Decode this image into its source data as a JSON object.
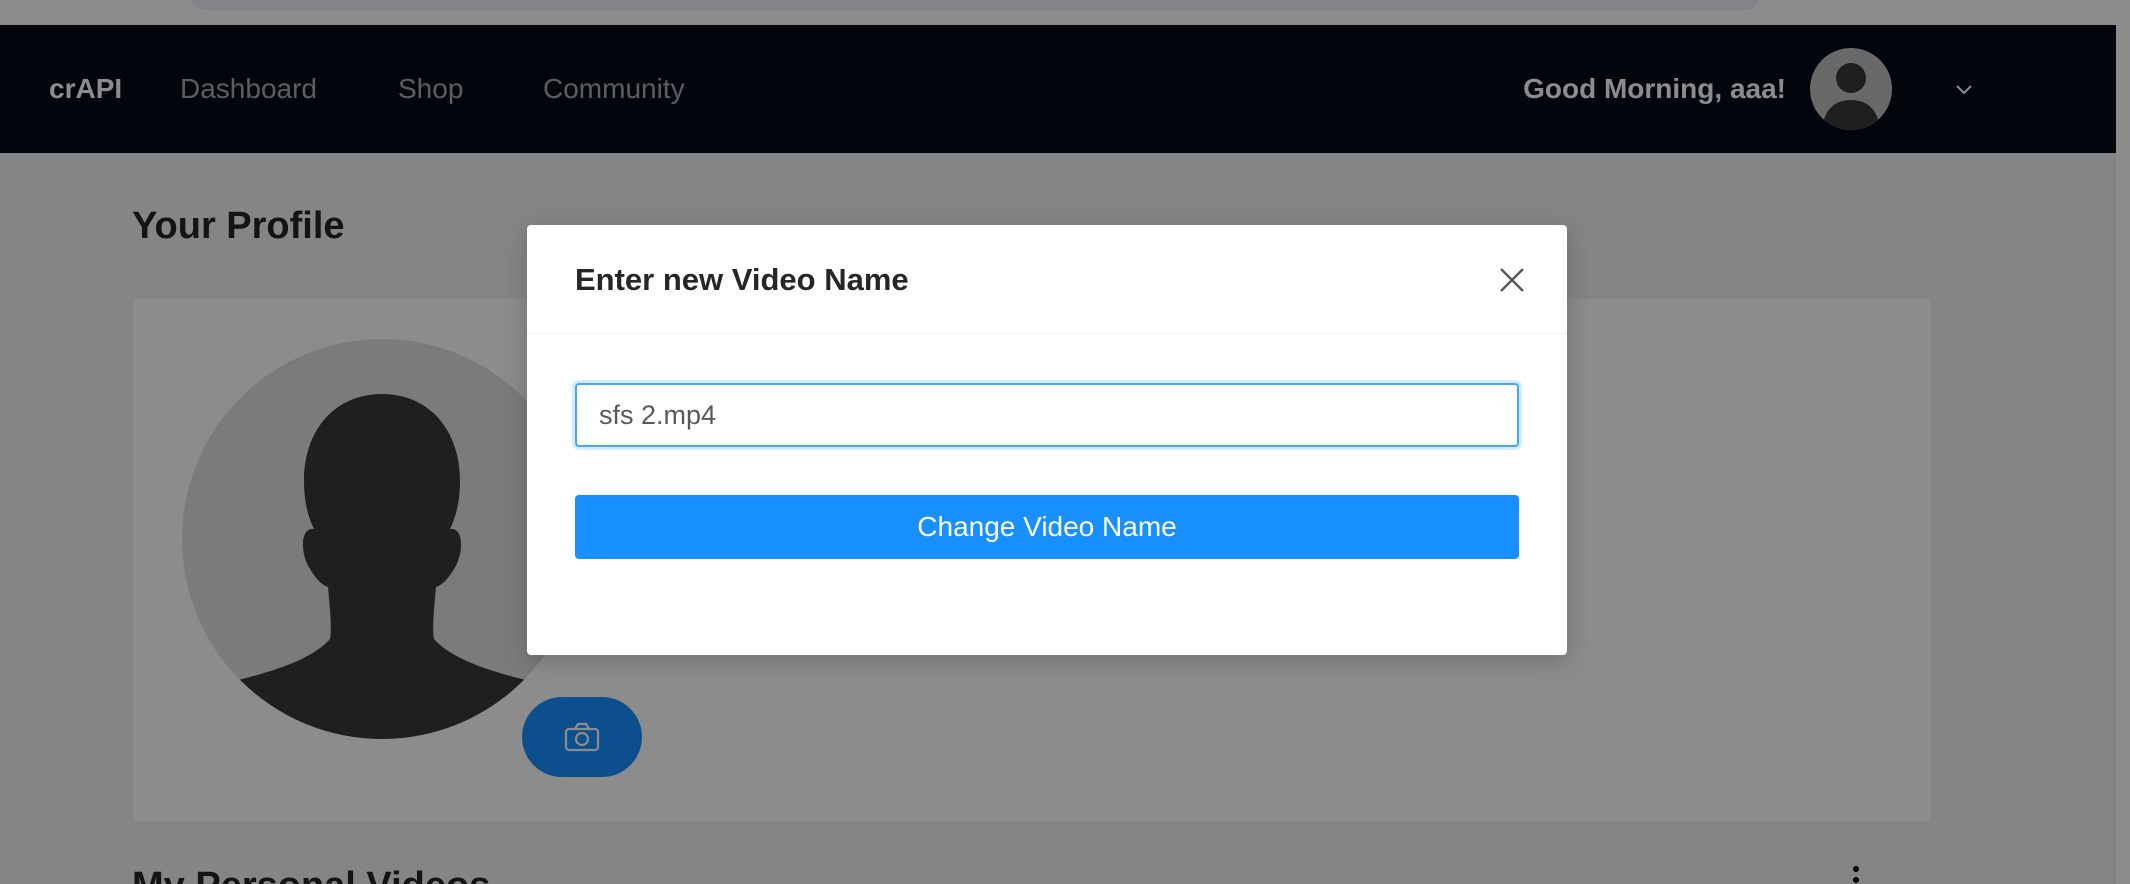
{
  "navbar": {
    "brand": "crAPI",
    "links": [
      "Dashboard",
      "Shop",
      "Community"
    ],
    "greeting": "Good Morning, aaa!",
    "avatar_icon": "user-silhouette-icon",
    "chevron_icon": "chevron-down-icon"
  },
  "profile": {
    "title": "Your Profile",
    "avatar_icon": "user-silhouette-icon",
    "camera_icon": "camera-icon"
  },
  "videos": {
    "heading": "My Personal Videos"
  },
  "modal": {
    "title": "Enter new Video Name",
    "close_icon": "close-icon",
    "input_value": "sfs 2.mp4",
    "button_label": "Change Video Name"
  },
  "colors": {
    "navbar_bg": "#000c17",
    "primary": "#1890ff",
    "overlay": "rgba(0,0,0,0.45)"
  }
}
